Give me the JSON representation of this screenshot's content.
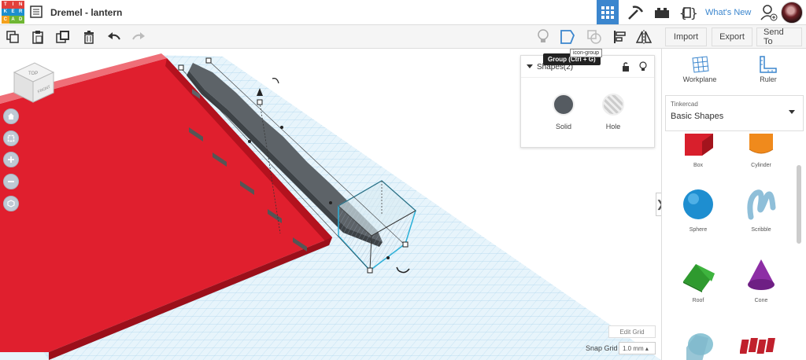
{
  "app": {
    "title": "Dremel - lantern",
    "logo_letters": [
      "T",
      "I",
      "N",
      "K",
      "E",
      "R",
      "C",
      "A",
      "D"
    ]
  },
  "topbar": {
    "whats_new": "What's New"
  },
  "toolbar": {
    "import": "Import",
    "export": "Export",
    "send_to": "Send To"
  },
  "tooltip": {
    "text": "Group (Ctrl + G)",
    "alt": "icon-group"
  },
  "inspector": {
    "title": "Shapes(2)",
    "solid": "Solid",
    "hole": "Hole"
  },
  "viewcube": {
    "top": "TOP",
    "front": "FRONT"
  },
  "grid": {
    "edit": "Edit Grid",
    "snap_label": "Snap Grid",
    "snap_value": "1.0 mm ▴"
  },
  "panel": {
    "tools": [
      {
        "label": "Workplane",
        "icon": "workplane-icon"
      },
      {
        "label": "Ruler",
        "icon": "ruler-icon"
      }
    ],
    "library_source": "Tinkercad",
    "library_name": "Basic Shapes",
    "shapes": [
      "Box",
      "Cylinder",
      "Sphere",
      "Scribble",
      "Roof",
      "Cone"
    ]
  },
  "colors": {
    "accent": "#3b86ce",
    "box": "#dd1c2c",
    "grid": "#cce6f3",
    "selection": "#2bb0d8"
  }
}
